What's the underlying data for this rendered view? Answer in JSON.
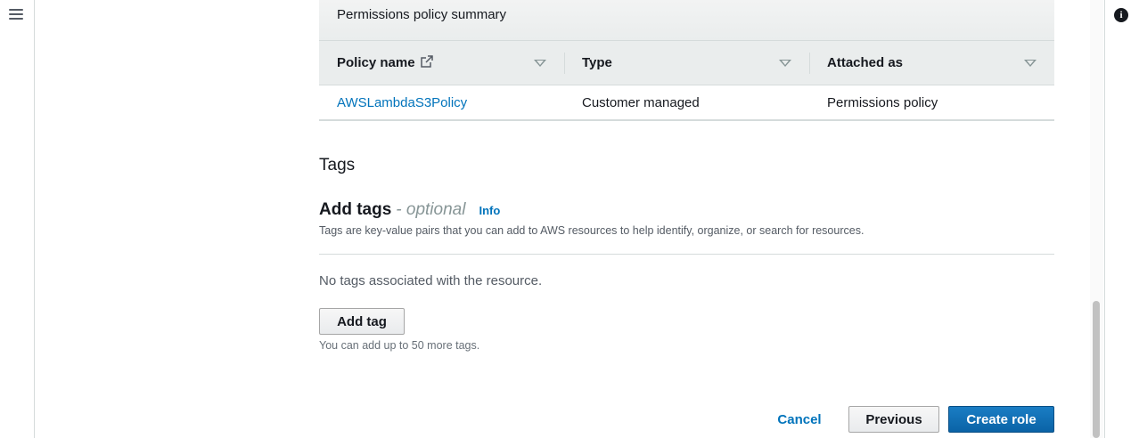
{
  "policy_summary": {
    "title": "Permissions policy summary",
    "columns": [
      "Policy name",
      "Type",
      "Attached as"
    ],
    "rows": [
      {
        "policy_name": "AWSLambdaS3Policy",
        "type": "Customer managed",
        "attached_as": "Permissions policy"
      }
    ]
  },
  "tags": {
    "section_title": "Tags",
    "heading": "Add tags",
    "optional": "- optional",
    "info_link": "Info",
    "description": "Tags are key-value pairs that you can add to AWS resources to help identify, organize, or search for resources.",
    "empty_message": "No tags associated with the resource.",
    "add_button": "Add tag",
    "limit_hint": "You can add up to 50 more tags."
  },
  "footer": {
    "cancel": "Cancel",
    "previous": "Previous",
    "create": "Create role"
  },
  "icons": {
    "menu": "hamburger-menu-icon",
    "info": "info-circle-icon",
    "external": "external-link-icon",
    "sort": "sort-caret-icon"
  },
  "colors": {
    "link": "#0073bb",
    "primary_button": "#0a63a6",
    "header_bg": "#eaeded"
  }
}
